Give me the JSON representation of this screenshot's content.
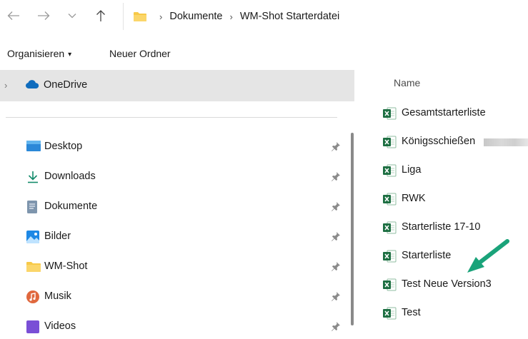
{
  "address_bar": {
    "breadcrumbs": [
      "Dokumente",
      "WM-Shot Starterdatei"
    ],
    "separator": "›"
  },
  "command_bar": {
    "organize_label": "Organisieren",
    "organize_caret": "▾",
    "new_folder_label": "Neuer Ordner"
  },
  "nav_pane": {
    "onedrive_label": "OneDrive",
    "items": [
      {
        "label": "Desktop",
        "icon": "desktop-icon"
      },
      {
        "label": "Downloads",
        "icon": "download-icon"
      },
      {
        "label": "Dokumente",
        "icon": "documents-icon"
      },
      {
        "label": "Bilder",
        "icon": "pictures-icon"
      },
      {
        "label": "WM-Shot",
        "icon": "folder-icon"
      },
      {
        "label": "Musik",
        "icon": "music-icon"
      },
      {
        "label": "Videos",
        "icon": "videos-icon"
      }
    ]
  },
  "content": {
    "column_header": "Name",
    "files": [
      {
        "label": "Gesamtstarterliste"
      },
      {
        "label": "Königsschießen"
      },
      {
        "label": "Liga"
      },
      {
        "label": "RWK"
      },
      {
        "label": "Starterliste 17-10"
      },
      {
        "label": "Starterliste"
      },
      {
        "label": "Test Neue Version3"
      },
      {
        "label": "Test"
      }
    ]
  },
  "colors": {
    "selected_bg": "#e5e5e5",
    "excel_green": "#1d6f42",
    "annotation_arrow": "#1aa37a",
    "folder_yellow": "#f7c948"
  }
}
